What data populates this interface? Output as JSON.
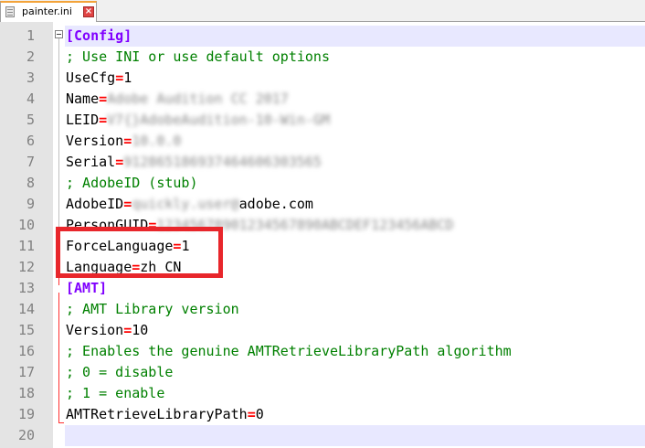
{
  "tab": {
    "title": "painter.ini",
    "icon": "file-icon",
    "close_icon": "close-icon"
  },
  "colors": {
    "section": "#8000ff",
    "comment": "#008000",
    "operator": "#ff0000",
    "highlight": "#e8262b",
    "current_line": "#e8e8ff"
  },
  "lines": [
    {
      "n": "1",
      "kind": "section",
      "text": "[Config]"
    },
    {
      "n": "2",
      "kind": "comment",
      "text": "; Use INI or use default options"
    },
    {
      "n": "3",
      "kind": "kv",
      "key": "UseCfg",
      "eq": "=",
      "value": "1"
    },
    {
      "n": "4",
      "kind": "kv",
      "key": "Name",
      "eq": "=",
      "value": "Adobe Audition CC 2017",
      "blurred": true
    },
    {
      "n": "5",
      "kind": "kv",
      "key": "LEID",
      "eq": "=",
      "value": "V7{}AdobeAudition-10-Win-GM",
      "blurred": true
    },
    {
      "n": "6",
      "kind": "kv",
      "key": "Version",
      "eq": "=",
      "value": "10.0.0",
      "blurred": true
    },
    {
      "n": "7",
      "kind": "kv",
      "key": "Serial",
      "eq": "=",
      "value": "912865186937464606303565",
      "blurred": true
    },
    {
      "n": "8",
      "kind": "comment",
      "text": "; AdobeID (stub)"
    },
    {
      "n": "9",
      "kind": "kv",
      "key": "AdobeID",
      "eq": "=",
      "value_blur": "quickly.user@",
      "value": "adobe.com"
    },
    {
      "n": "10",
      "kind": "kv",
      "key": "PersonGUID",
      "eq": "=",
      "value": "12345678901234567890ABCDEF123456ABCD",
      "blurred": true
    },
    {
      "n": "11",
      "kind": "kv",
      "key": "ForceLanguage",
      "eq": "=",
      "value": "1"
    },
    {
      "n": "12",
      "kind": "kv",
      "key": "Language",
      "eq": "=",
      "value": "zh_CN"
    },
    {
      "n": "13",
      "kind": "section",
      "text": "[AMT]"
    },
    {
      "n": "14",
      "kind": "comment",
      "text": "; AMT Library version"
    },
    {
      "n": "15",
      "kind": "kv",
      "key": "Version",
      "eq": "=",
      "value": "10"
    },
    {
      "n": "16",
      "kind": "comment",
      "text": "; Enables the genuine AMTRetrieveLibraryPath algorithm"
    },
    {
      "n": "17",
      "kind": "comment",
      "text": "; 0 = disable"
    },
    {
      "n": "18",
      "kind": "comment",
      "text": "; 1 = enable"
    },
    {
      "n": "19",
      "kind": "kv",
      "key": "AMTRetrieveLibraryPath",
      "eq": "=",
      "value": "0"
    },
    {
      "n": "20",
      "kind": "empty",
      "text": ""
    }
  ]
}
